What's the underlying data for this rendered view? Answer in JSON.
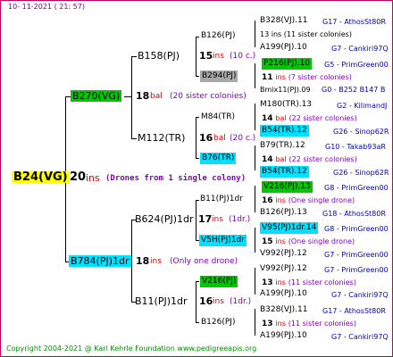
{
  "header": "10-  11-2021  ( 21:  57)",
  "footer": "Copyright 2004-2021 @ Karl Kehrle Foundation    www.pedigreeapis.org",
  "root": {
    "name": "B24(VG)",
    "count": "20",
    "unit": "ins",
    "note": "(Drones from 1 single colony)"
  },
  "gen1": [
    {
      "name": "B270(VG)",
      "count": "18",
      "unit": "bal",
      "note": "(20 sister colonies)"
    },
    {
      "name": "B784(PJ)1dr",
      "count": "18",
      "unit": "ins",
      "note": "(Only one drone)"
    }
  ],
  "gen2": [
    {
      "name": "B158(PJ)",
      "count": "15",
      "unit": "ins",
      "note": "(10 c.)"
    },
    {
      "name": "M112(TR)",
      "count": "16",
      "unit": "bal",
      "note": "(20 c.)"
    },
    {
      "name": "B624(PJ)1dr",
      "count": "17",
      "unit": "ins",
      "note": "(1dr.)"
    },
    {
      "name": "B11(PJ)1dr",
      "count": "16",
      "unit": "ins",
      "note": "(1dr.)"
    }
  ],
  "gen3": [
    {
      "name": "B126(PJ)"
    },
    {
      "name": "B294(PJ)",
      "count": "11",
      "unit": "ins",
      "note": "(7 sister colonies)"
    },
    {
      "name": "M84(TR)",
      "count": "14",
      "unit": "bal",
      "note": "(22 sister colonies)"
    },
    {
      "name": "B76(TR)",
      "count": "14",
      "unit": "bal",
      "note": "(22 sister colonies)"
    },
    {
      "name": "B11(PJ)1dr",
      "count": "16",
      "unit": "ins",
      "note": "(One single drone)"
    },
    {
      "name": "V5H(PJ)1dr",
      "count": "15",
      "unit": "ins",
      "note": "(One single drone)"
    },
    {
      "name": "V216(PJ)",
      "count": "13",
      "unit": "ins",
      "note": "(11 sister colonies)"
    },
    {
      "name": "B126(PJ)",
      "count": "13",
      "unit": "ins",
      "note": "(11 sister colonies)"
    }
  ],
  "gen4": [
    {
      "name": "B328(VJ).11",
      "info": "G17 - AthosSt80R"
    },
    {
      "name": "13 ins (11 sister colonies)"
    },
    {
      "name": "A199(PJ).10",
      "info": "G7 - Cankiri97Q"
    },
    {
      "name": "P216(PJ).10",
      "info": "G5 - PrimGreen00"
    },
    {
      "name": "Bmix11(PJ).09",
      "info": "G0 - B252 B147 B"
    },
    {
      "name": "M180(TR).13",
      "info": "G2 - KilimandJ"
    },
    {
      "name": "B54(TR).12",
      "info": "G26 - Sinop62R"
    },
    {
      "name": "B79(TR).12",
      "info": "G10 - Takab93aR"
    },
    {
      "name": "B54(TR).12",
      "info": "G26 - Sinop62R"
    },
    {
      "name": "V216(PJ).13",
      "info": "G8 - PrimGreen00"
    },
    {
      "name": "B126(PJ).13",
      "info": "G18 - AthosSt80R"
    },
    {
      "name": "V95(PJ)1dr.14",
      "info": "G8 - PrimGreen00"
    },
    {
      "name": "V992(PJ).12",
      "info": "G7 - PrimGreen00"
    },
    {
      "name": "V992(PJ).12",
      "info": "G7 - PrimGreen00"
    },
    {
      "name": "A199(PJ).10",
      "info": "G7 - Cankiri97Q"
    },
    {
      "name": "B328(VJ).11",
      "info": "G17 - AthosSt80R"
    },
    {
      "name": "A199(PJ).10",
      "info": "G7 - Cankiri97Q"
    }
  ],
  "colors": {
    "green": "#00c800",
    "cyan": "#00e0ff",
    "gray": "#a8a8a8",
    "yellow": "#ffff00",
    "red": "#e00000",
    "purple": "#8000c0",
    "blue": "#0000c0"
  }
}
